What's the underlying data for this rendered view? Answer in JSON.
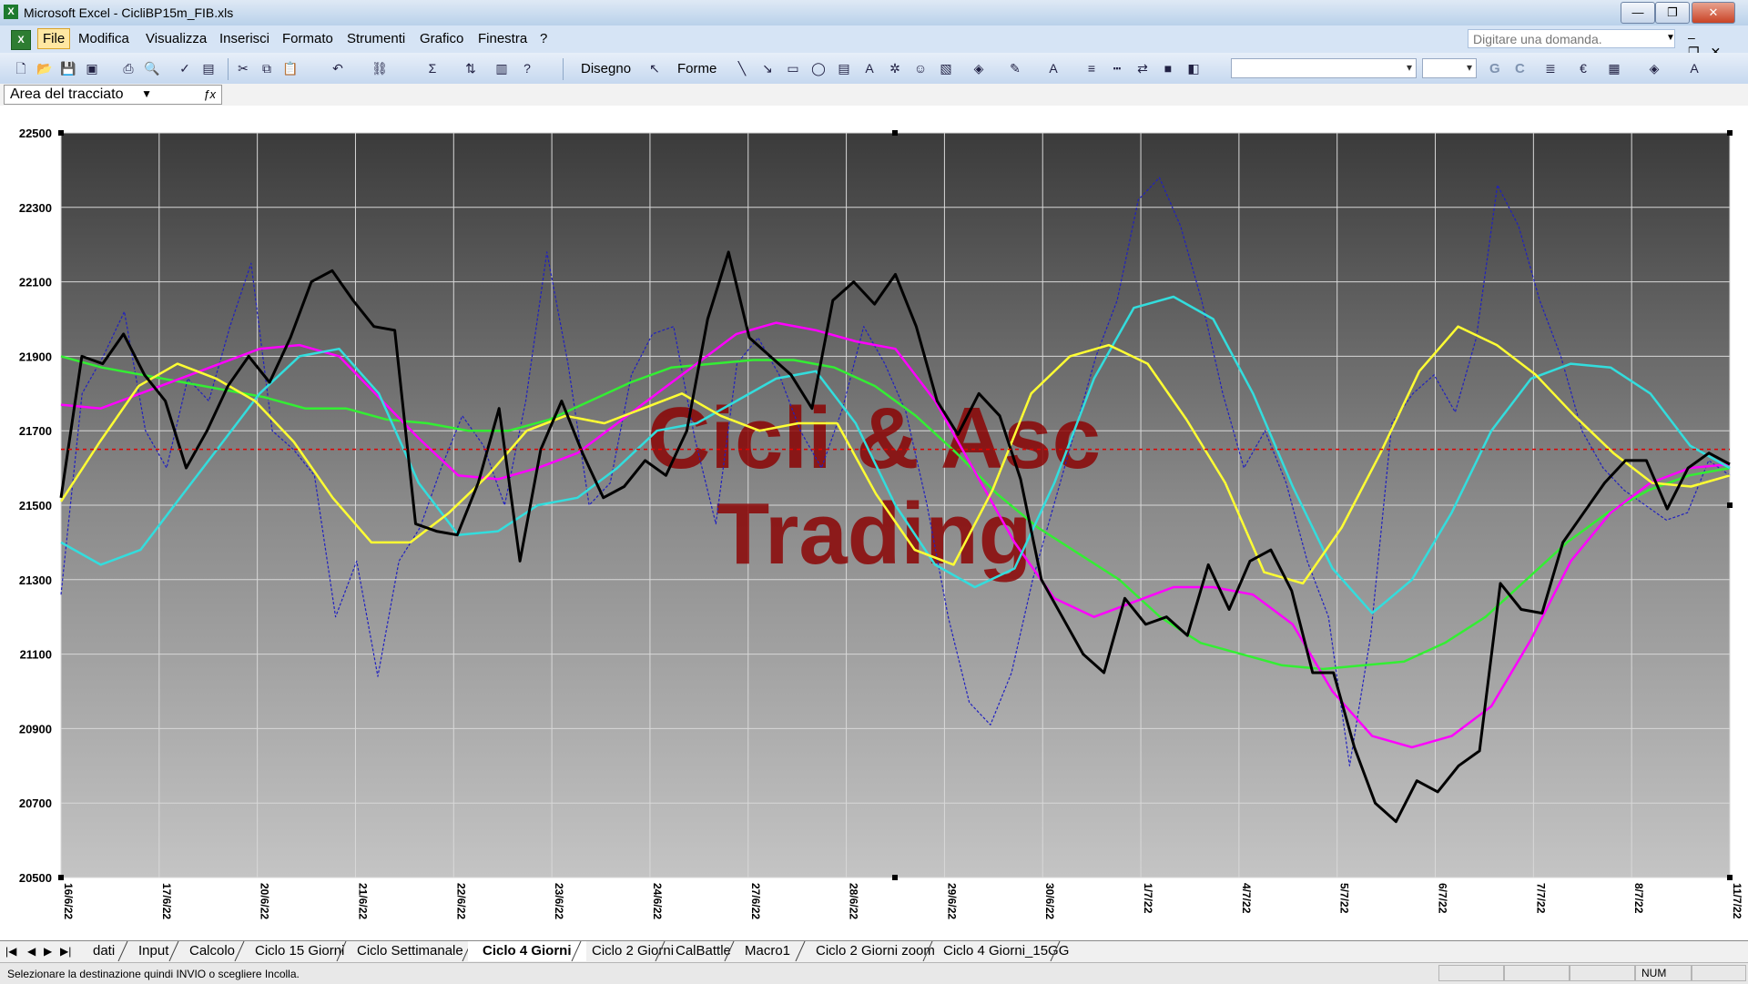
{
  "window": {
    "title": "Microsoft Excel - CicliBP15m_FIB.xls",
    "min": "—",
    "max": "❐",
    "close": "✕"
  },
  "menu": {
    "items": [
      "File",
      "Modifica",
      "Visualizza",
      "Inserisci",
      "Formato",
      "Strumenti",
      "Grafico",
      "Finestra",
      "?"
    ],
    "help_placeholder": "Digitare una domanda."
  },
  "toolbar": {
    "disegno": "Disegno",
    "forme": "Forme",
    "bold": "G",
    "italic": "C"
  },
  "namebox": {
    "value": "Area del tracciato"
  },
  "chart_data": {
    "type": "line",
    "watermark": [
      "Cicli & Asc",
      "Trading"
    ],
    "ylim": [
      20500,
      22500
    ],
    "y_ticks": [
      22500,
      22300,
      22100,
      21900,
      21700,
      21500,
      21300,
      21100,
      20900,
      20700,
      20500
    ],
    "x_tick_labels": [
      "16/6/22",
      "17/6/22",
      "20/6/22",
      "21/6/22",
      "22/6/22",
      "23/6/22",
      "24/6/22",
      "27/6/22",
      "28/6/22",
      "29/6/22",
      "30/6/22",
      "1/7/22",
      "4/7/22",
      "5/7/22",
      "6/7/22",
      "7/7/22",
      "8/7/22",
      "11/7/22"
    ],
    "reference_line": {
      "value": 21650,
      "color": "#e00000",
      "style": "dotted"
    },
    "colors": {
      "price": "#000000",
      "cycle_blue": "#2020c0",
      "magenta": "#ff00ff",
      "cyan": "#33dddd",
      "yellow": "#ffff33",
      "green": "#33ee33"
    },
    "series": [
      {
        "style": "price",
        "values": [
          21520,
          21900,
          21880,
          21960,
          21850,
          21780,
          21600,
          21700,
          21820,
          21900,
          21830,
          21950,
          22100,
          22130,
          22050,
          21980,
          21970,
          21450,
          21430,
          21420,
          21560,
          21760,
          21350,
          21650,
          21780,
          21640,
          21520,
          21550,
          21620,
          21580,
          21700,
          22000,
          22180,
          21950,
          21900,
          21850,
          21760,
          22050,
          22100,
          22040,
          22120,
          21980,
          21780,
          21690,
          21800,
          21740,
          21570,
          21300,
          21200,
          21100,
          21050,
          21250,
          21180,
          21200,
          21150,
          21340,
          21220,
          21350,
          21380,
          21270,
          21050,
          21050,
          20850,
          20700,
          20650,
          20760,
          20730,
          20800,
          20840,
          21290,
          21220,
          21210,
          21400,
          21480,
          21560,
          21620,
          21620,
          21490,
          21600,
          21640,
          21610
        ]
      },
      {
        "style": "cycle_blue",
        "values": [
          21260,
          21800,
          21900,
          22020,
          21700,
          21600,
          21840,
          21780,
          21980,
          22150,
          21700,
          21650,
          21580,
          21200,
          21350,
          21040,
          21350,
          21440,
          21600,
          21740,
          21660,
          21500,
          21780,
          22180,
          21880,
          21500,
          21560,
          21850,
          21960,
          21980,
          21680,
          21450,
          21880,
          21950,
          21850,
          21700,
          21600,
          21760,
          21980,
          21880,
          21750,
          21500,
          21200,
          20970,
          20910,
          21050,
          21300,
          21500,
          21700,
          21900,
          22050,
          22320,
          22380,
          22250,
          22050,
          21800,
          21600,
          21700,
          21560,
          21350,
          21200,
          20800,
          21150,
          21720,
          21800,
          21850,
          21750,
          21950,
          22360,
          22250,
          22050,
          21900,
          21700,
          21600,
          21540,
          21500,
          21460,
          21480,
          21620,
          21580
        ]
      },
      {
        "style": "magenta",
        "values": [
          21770,
          21760,
          21800,
          21840,
          21880,
          21920,
          21930,
          21900,
          21790,
          21680,
          21580,
          21570,
          21600,
          21640,
          21720,
          21800,
          21880,
          21960,
          21990,
          21970,
          21940,
          21920,
          21780,
          21590,
          21400,
          21250,
          21200,
          21240,
          21280,
          21280,
          21260,
          21180,
          21000,
          20880,
          20850,
          20880,
          20960,
          21140,
          21350,
          21480,
          21560,
          21600,
          21610
        ]
      },
      {
        "style": "cyan",
        "values": [
          21400,
          21340,
          21380,
          21520,
          21660,
          21800,
          21900,
          21920,
          21800,
          21560,
          21420,
          21430,
          21500,
          21520,
          21600,
          21700,
          21720,
          21780,
          21840,
          21860,
          21720,
          21500,
          21340,
          21280,
          21330,
          21560,
          21840,
          22030,
          22060,
          22000,
          21800,
          21550,
          21330,
          21210,
          21300,
          21480,
          21700,
          21840,
          21880,
          21870,
          21800,
          21660,
          21600
        ]
      },
      {
        "style": "yellow",
        "values": [
          21510,
          21670,
          21820,
          21880,
          21840,
          21780,
          21670,
          21520,
          21400,
          21400,
          21480,
          21580,
          21700,
          21740,
          21720,
          21760,
          21800,
          21740,
          21700,
          21720,
          21720,
          21530,
          21380,
          21340,
          21540,
          21800,
          21900,
          21930,
          21880,
          21730,
          21560,
          21320,
          21290,
          21440,
          21640,
          21860,
          21980,
          21930,
          21850,
          21740,
          21640,
          21560,
          21550,
          21580
        ]
      },
      {
        "style": "green",
        "values": [
          21900,
          21870,
          21850,
          21830,
          21810,
          21790,
          21760,
          21760,
          21730,
          21720,
          21700,
          21700,
          21730,
          21780,
          21830,
          21870,
          21880,
          21890,
          21890,
          21870,
          21820,
          21740,
          21640,
          21530,
          21440,
          21370,
          21300,
          21200,
          21130,
          21100,
          21070,
          21060,
          21070,
          21080,
          21130,
          21200,
          21300,
          21400,
          21480,
          21540,
          21580,
          21600
        ]
      }
    ]
  },
  "tabs": {
    "nav": [
      "|◀",
      "◀",
      "▶",
      "▶|"
    ],
    "items": [
      "dati",
      "Input",
      "Calcolo",
      "Ciclo 15 Giorni",
      "Ciclo Settimanale",
      "Ciclo 4 Giorni",
      "Ciclo 2 Giorni",
      "CalBattle",
      "Macro1",
      "Ciclo 2 Giorni zoom",
      "Ciclo 4 Giorni_15GG"
    ],
    "active": "Ciclo 4 Giorni"
  },
  "status": {
    "message": "Selezionare la destinazione quindi INVIO o scegliere Incolla.",
    "num": "NUM"
  }
}
